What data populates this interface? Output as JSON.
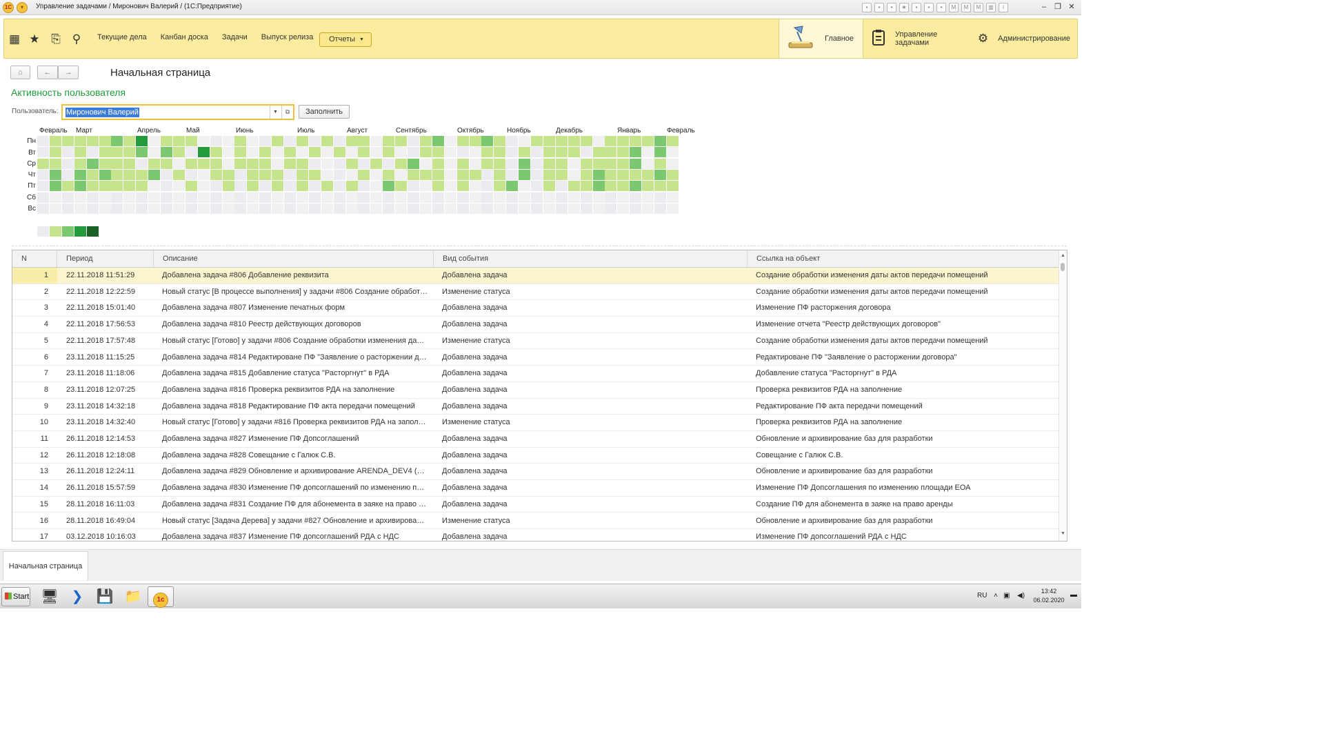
{
  "window": {
    "title": "Управление задачами / Миронович Валерий /  (1С:Предприятие)",
    "logo": "1C"
  },
  "section_bar": {
    "nav_links": [
      "Текущие дела",
      "Канбан доска",
      "Задачи",
      "Выпуск релиза"
    ],
    "reports_label": "Отчеты",
    "sections": [
      {
        "label": "Главное",
        "icon": "desk-lamp-icon",
        "active": true
      },
      {
        "label": "Управление задачами",
        "icon": "clipboard-icon",
        "active": false
      },
      {
        "label": "Администрирование",
        "icon": "gear-icon",
        "active": false
      }
    ]
  },
  "page": {
    "title": "Начальная страница",
    "activity_title": "Активность пользователя",
    "user_label": "Пользователь:",
    "user_value": "Миронович Валерий",
    "fill_button": "Заполнить"
  },
  "heatmap": {
    "months": [
      "Февраль",
      "Март",
      "Апрель",
      "Май",
      "Июнь",
      "Июль",
      "Август",
      "Сентябрь",
      "Октябрь",
      "Ноябрь",
      "Декабрь",
      "Январь",
      "Февраль"
    ],
    "days": [
      "Пн",
      "Вт",
      "Ср",
      "Чт",
      "Пт",
      "Сб",
      "Вс"
    ],
    "legend_levels": 5,
    "colors": [
      "#eeeeee",
      "#c6e48b",
      "#7bc96f",
      "#239a3b",
      "#196127"
    ]
  },
  "table": {
    "columns": [
      "N",
      "Период",
      "Описание",
      "Вид события",
      "Ссылка на объект"
    ],
    "rows": [
      [
        "1",
        "22.11.2018 11:51:29",
        "Добавлена задача #806 Добавление реквизита",
        "Добавлена задача",
        "Создание обработки изменения даты актов передачи помещений"
      ],
      [
        "2",
        "22.11.2018 12:22:59",
        "Новый статус [В процессе выполнения] у задачи #806 Создание обработк...",
        "Изменение статуса",
        "Создание обработки изменения даты актов передачи помещений"
      ],
      [
        "3",
        "22.11.2018 15:01:40",
        "Добавлена задача #807 Изменение печатных форм",
        "Добавлена задача",
        "Изменение ПФ расторжения договора"
      ],
      [
        "4",
        "22.11.2018 17:56:53",
        "Добавлена задача #810 Реестр действующих договоров",
        "Добавлена задача",
        "Изменение отчета \"Реестр действующих договоров\""
      ],
      [
        "5",
        "22.11.2018 17:57:48",
        "Новый статус [Готово] у задачи #806 Создание обработки изменения даты ...",
        "Изменение статуса",
        "Создание обработки изменения даты актов передачи помещений"
      ],
      [
        "6",
        "23.11.2018 11:15:25",
        "Добавлена задача #814 Редактироване ПФ \"Заявление о расторжении дог...",
        "Добавлена задача",
        "Редактироване ПФ \"Заявление о расторжении договора\""
      ],
      [
        "7",
        "23.11.2018 11:18:06",
        "Добавлена задача #815 Добавление статуса \"Расторгнут\" в РДА",
        "Добавлена задача",
        "Добавление статуса \"Расторгнут\" в РДА"
      ],
      [
        "8",
        "23.11.2018 12:07:25",
        "Добавлена задача #816 Проверка реквизитов РДА на заполнение",
        "Добавлена задача",
        "Проверка реквизитов РДА на заполнение"
      ],
      [
        "9",
        "23.11.2018 14:32:18",
        "Добавлена задача #818 Редактирование ПФ акта передачи помещений",
        "Добавлена задача",
        "Редактирование ПФ акта передачи помещений"
      ],
      [
        "10",
        "23.11.2018 14:32:40",
        "Новый статус [Готово] у задачи #816 Проверка реквизитов РДА на заполне...",
        "Изменение статуса",
        "Проверка реквизитов РДА на заполнение"
      ],
      [
        "11",
        "26.11.2018 12:14:53",
        "Добавлена задача #827 Изменение ПФ Допсоглашений",
        "Добавлена задача",
        "Обновление и архивирование баз для разработки"
      ],
      [
        "12",
        "26.11.2018 12:18:08",
        "Добавлена задача #828 Совещание с Галюк С.В.",
        "Добавлена задача",
        "Совещание с Галюк С.В."
      ],
      [
        "13",
        "26.11.2018 12:24:11",
        "Добавлена задача #829 Обновление и архивирование ARENDA_DEV4 (Дл...",
        "Добавлена задача",
        "Обновление и архивирование баз для разработки"
      ],
      [
        "14",
        "26.11.2018 15:57:59",
        "Добавлена задача #830 Изменение ПФ допсоглашений по изменению пло...",
        "Добавлена задача",
        "Изменение ПФ Допсоглашения по изменению площади ЕОА"
      ],
      [
        "15",
        "28.11.2018 16:11:03",
        "Добавлена задача #831 Создание ПФ для абонемента в заяке на право ар...",
        "Добавлена задача",
        "Создание ПФ для абонемента в заяке на право аренды"
      ],
      [
        "16",
        "28.11.2018 16:49:04",
        "Новый статус [Задача Дерева] у задачи #827 Обновление и архивировани...",
        "Изменение статуса",
        "Обновление и архивирование баз для разработки"
      ],
      [
        "17",
        "03.12.2018 10:16:03",
        "Добавлена задача #837 Изменение ПФ допсоглашений РДА с НДС",
        "Добавлена задача",
        "Изменение ПФ допсоглашений РДА с НДС"
      ]
    ]
  },
  "bottom_tab": "Начальная страница",
  "taskbar": {
    "start_label": "Start",
    "lang": "RU",
    "time": "13:42",
    "date": "06.02.2020"
  }
}
